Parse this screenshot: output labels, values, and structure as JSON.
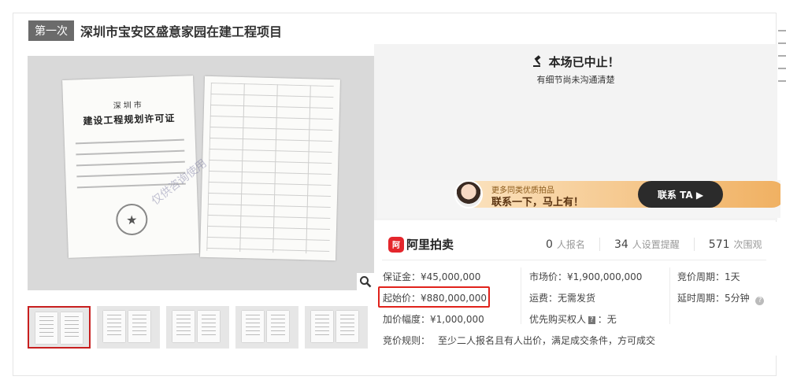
{
  "header": {
    "round_badge": "第一次",
    "title": "深圳市宝安区盛意家园在建工程项目"
  },
  "gallery": {
    "doc_title_small": "深圳市",
    "doc_title_large": "建设工程规划许可证",
    "watermark": "仅供咨询使用",
    "zoom_icon": "magnifier-icon",
    "thumbnail_count": 5,
    "active_thumbnail": 1
  },
  "status": {
    "icon": "gavel-icon",
    "title": "本场已中止！",
    "subtitle": "有细节尚未沟通清楚"
  },
  "promo": {
    "line1": "更多同类优质拍品",
    "line2": "联系一下，马上有！",
    "cta": "联系 TA ▶"
  },
  "brand": {
    "logo_glyph": "阿",
    "name": "阿里拍卖"
  },
  "stats": [
    {
      "num": "0",
      "label": "人报名"
    },
    {
      "num": "34",
      "label": "人设置提醒"
    },
    {
      "num": "571",
      "label": "次围观"
    }
  ],
  "details": {
    "deposit_label": "保证金：",
    "deposit_value": "¥45,000,000",
    "market_label": "市场价：",
    "market_value": "¥1,900,000,000",
    "cycle_label": "竞价周期：",
    "cycle_value": "1天",
    "start_label": "起始价：",
    "start_value": "¥880,000,000",
    "shipping_label": "运费：",
    "shipping_value": "无需发货",
    "delay_label": "延时周期：",
    "delay_value": "5分钟",
    "increment_label": "加价幅度：",
    "increment_value": "¥1,000,000",
    "priority_label": "优先购买权人",
    "priority_tag": "?",
    "priority_value": "：无",
    "rule_label": "竞价规则：",
    "rule_value": "至少二人报名且有人出价，满足成交条件，方可成交"
  },
  "colors": {
    "highlight": "#e0221b",
    "brand_red": "#e4262c",
    "cta_bg": "#2b2b2b"
  }
}
